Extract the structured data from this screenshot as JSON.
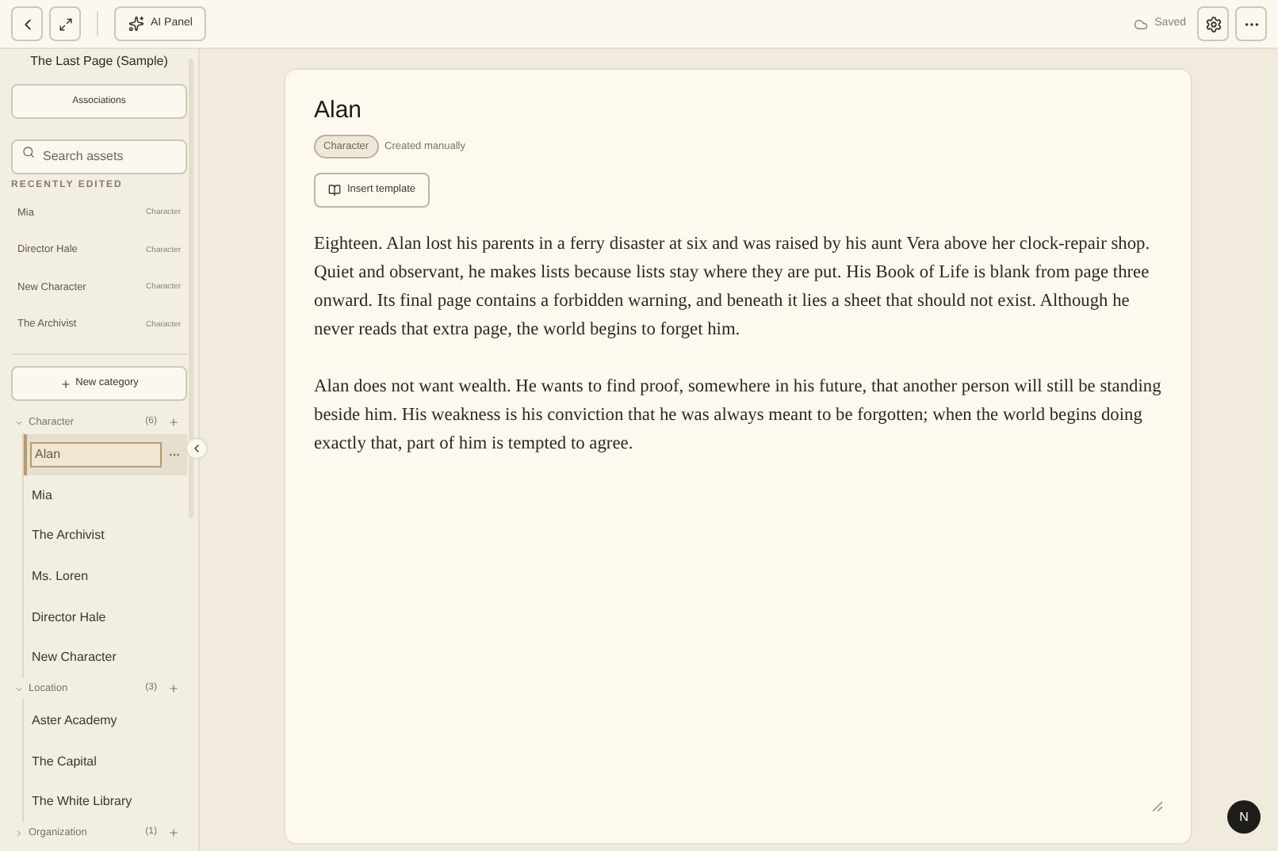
{
  "toolbar": {
    "ai_panel_label": "AI Panel",
    "saved_label": "Saved"
  },
  "sidebar": {
    "project_title": "The Last Page (Sample)",
    "associations_button": "Associations",
    "search_placeholder": "Search assets",
    "recently_edited_heading": "RECENTLY EDITED",
    "recent": [
      {
        "name": "Mia",
        "type": "Character"
      },
      {
        "name": "Director Hale",
        "type": "Character"
      },
      {
        "name": "New Character",
        "type": "Character"
      },
      {
        "name": "The Archivist",
        "type": "Character"
      }
    ],
    "new_category_button": "New category",
    "categories": [
      {
        "name": "Character",
        "count": "(6)",
        "expanded": true,
        "children": [
          {
            "name": "Alan",
            "selected": true
          },
          {
            "name": "Mia",
            "selected": false
          },
          {
            "name": "The Archivist",
            "selected": false
          },
          {
            "name": "Ms. Loren",
            "selected": false
          },
          {
            "name": "Director Hale",
            "selected": false
          },
          {
            "name": "New Character",
            "selected": false
          }
        ]
      },
      {
        "name": "Location",
        "count": "(3)",
        "expanded": true,
        "children": [
          {
            "name": "Aster Academy",
            "selected": false
          },
          {
            "name": "The Capital",
            "selected": false
          },
          {
            "name": "The White Library",
            "selected": false
          }
        ]
      },
      {
        "name": "Organization",
        "count": "(1)",
        "expanded": false
      }
    ]
  },
  "document": {
    "title": "Alan",
    "tag": "Character",
    "source": "Created manually",
    "insert_template_button": "Insert template",
    "paragraphs": [
      "Eighteen. Alan lost his parents in a ferry disaster at six and was raised by his aunt Vera above her clock-repair shop. Quiet and observant, he makes lists because lists stay where they are put. His Book of Life is blank from page three onward. Its final page contains a forbidden warning, and beneath it lies a sheet that should not exist. Although he never reads that extra page, the world begins to forget him.",
      "Alan does not want wealth. He wants to find proof, somewhere in his future, that another person will still be standing beside him. His weakness is his conviction that he was always meant to be forgotten; when the world begins doing exactly that, part of him is tempted to agree."
    ]
  },
  "avatar_letter": "N"
}
